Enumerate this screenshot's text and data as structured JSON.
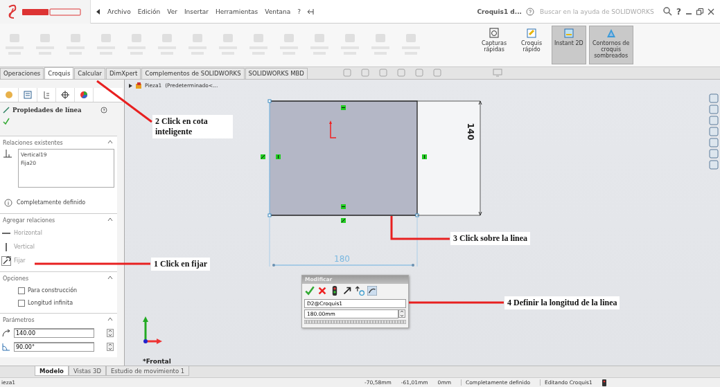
{
  "title_bar": {
    "menu": [
      "Archivo",
      "Edición",
      "Ver",
      "Insertar",
      "Herramientas",
      "Ventana",
      "?"
    ],
    "document": "Croquis1 d...",
    "search": {
      "placeholder": "Buscar en la ayuda de SOLIDWORKS"
    },
    "help": "?"
  },
  "ribbon": {
    "buttons": [
      {
        "label": "Capturas rápidas",
        "kind": "capture",
        "selected": false
      },
      {
        "label": "Croquis rápido",
        "kind": "quick",
        "selected": false
      },
      {
        "label": "Instant 2D",
        "kind": "instant",
        "selected": true
      },
      {
        "label": "Contornos de croquis sombreados",
        "kind": "contour",
        "selected": true
      }
    ]
  },
  "tabs": [
    {
      "label": "Operaciones",
      "selected": false
    },
    {
      "label": "Croquis",
      "selected": true
    },
    {
      "label": "Calcular",
      "selected": false
    },
    {
      "label": "DimXpert",
      "selected": false
    },
    {
      "label": "Complementos de SOLIDWORKS",
      "selected": false
    },
    {
      "label": "SOLIDWORKS MBD",
      "selected": false
    }
  ],
  "property_manager": {
    "title": "Propiedades de línea",
    "existing_relations": {
      "heading": "Relaciones existentes",
      "items": [
        "Vertical19",
        "Fija20"
      ]
    },
    "status": "Completamente definido",
    "add_relations": {
      "heading": "Agregar relaciones",
      "items": [
        {
          "label": "Horizontal",
          "kind": "horizontal"
        },
        {
          "label": "Vertical",
          "kind": "vertical"
        },
        {
          "label": "Fijar",
          "kind": "fix"
        }
      ]
    },
    "options": {
      "heading": "Opciones",
      "items": [
        {
          "label": "Para construcción",
          "checked": false
        },
        {
          "label": "Longitud infinita",
          "checked": false
        }
      ]
    },
    "parameters": {
      "heading": "Parámetros",
      "fields": [
        {
          "value": "140.00",
          "kind": "length"
        },
        {
          "value": "90.00°",
          "kind": "angle"
        }
      ]
    }
  },
  "feature_tree": {
    "item": "Pieza1  (Predeterminado<..."
  },
  "sketch": {
    "width_dimension": "180",
    "height_dimension": "140"
  },
  "view_label": "*Frontal",
  "modify_dialog": {
    "title": "Modificar",
    "name": "D2@Croquis1",
    "value": "180.00mm"
  },
  "annotations": [
    {
      "text": "2 Click en cota inteligente"
    },
    {
      "text": "3 Click sobre la linea"
    },
    {
      "text": "1 Click en fijar"
    },
    {
      "text": "4 Definir la longitud de la linea"
    }
  ],
  "bottom_tabs": [
    {
      "label": "Modelo",
      "selected": true
    },
    {
      "label": "Vistas 3D",
      "selected": false
    },
    {
      "label": "Estudio de movimiento 1",
      "selected": false
    }
  ],
  "status_bar": {
    "document": "ieza1",
    "x": "-70,58mm",
    "y": "-61,01mm",
    "z": "0mm",
    "state": "Completamente definido",
    "mode": "Editando Croquis1"
  }
}
